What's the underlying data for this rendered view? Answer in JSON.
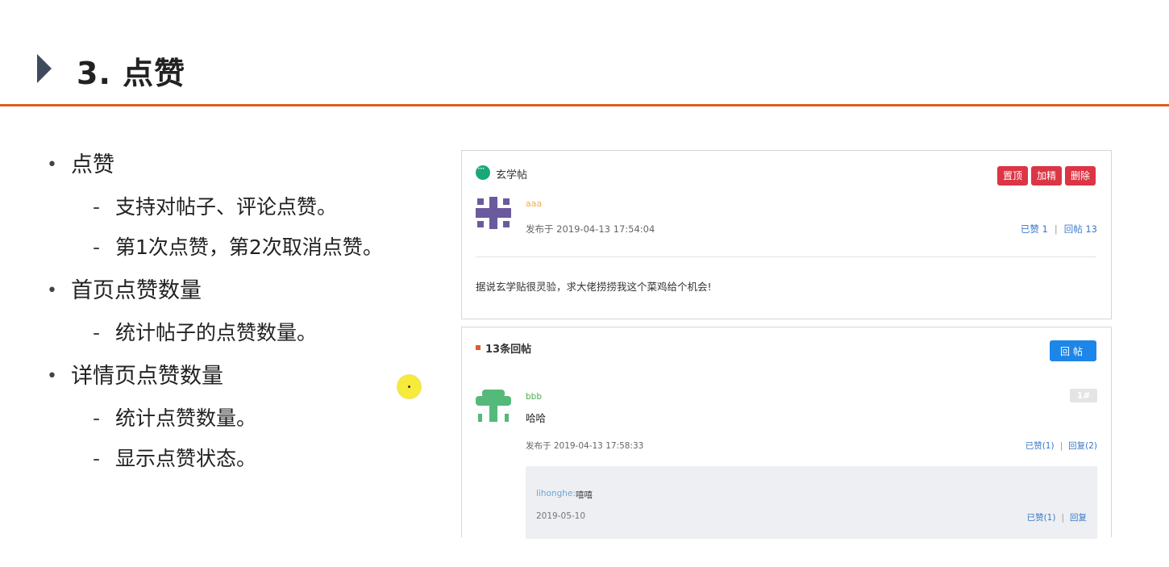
{
  "slide": {
    "title": "3. 点赞"
  },
  "bullets": [
    {
      "text": "点赞",
      "subs": [
        "支持对帖子、评论点赞。",
        "第1次点赞，第2次取消点赞。"
      ]
    },
    {
      "text": "首页点赞数量",
      "subs": [
        "统计帖子的点赞数量。"
      ]
    },
    {
      "text": "详情页点赞数量",
      "subs": [
        "统计点赞数量。",
        "显示点赞状态。"
      ]
    }
  ],
  "post": {
    "board_name": "玄学帖",
    "buttons": {
      "top": "置顶",
      "essence": "加精",
      "delete": "删除"
    },
    "author": "aaa",
    "time": "发布于 2019-04-13 17:54:04",
    "likes": "已赞 1",
    "replies": "回帖 13",
    "content": "据说玄学贴很灵验，求大佬捞捞我这个菜鸡给个机会!",
    "avatar_color": "#6b5a9e"
  },
  "reply_section": {
    "count_label": "13条回帖",
    "reply_button": "回帖",
    "reply": {
      "author": "bbb",
      "floor": "1#",
      "content": "哈哈",
      "time": "发布于 2019-04-13 17:58:33",
      "likes": "已赞(1)",
      "replies": "回复(2)",
      "avatar_color": "#55b97a"
    },
    "sub_reply": {
      "author": "lihonghe:",
      "content": "嘻嘻",
      "date": "2019-05-10",
      "likes": "已赞(1)",
      "reply": "回复"
    }
  },
  "colors": {
    "accent_rule": "#d9601f",
    "danger": "#dc3545",
    "primary": "#1e86e8"
  }
}
